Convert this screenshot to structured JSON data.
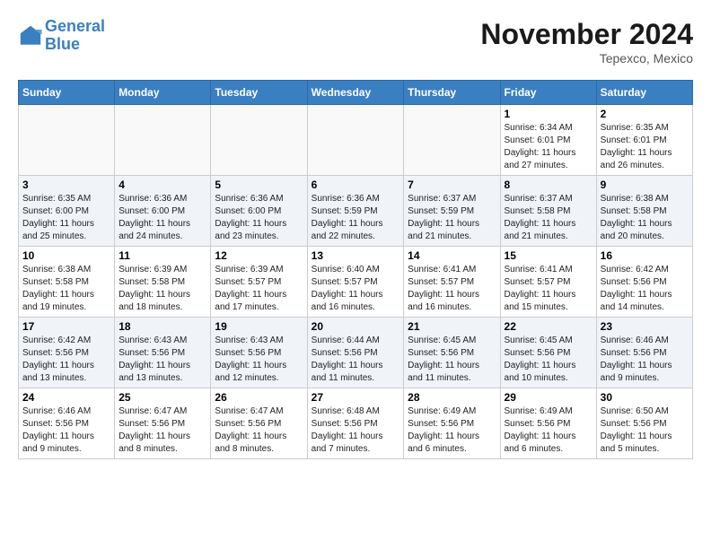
{
  "header": {
    "logo_line1": "General",
    "logo_line2": "Blue",
    "month": "November 2024",
    "location": "Tepexco, Mexico"
  },
  "weekdays": [
    "Sunday",
    "Monday",
    "Tuesday",
    "Wednesday",
    "Thursday",
    "Friday",
    "Saturday"
  ],
  "weeks": [
    [
      {
        "day": "",
        "info": ""
      },
      {
        "day": "",
        "info": ""
      },
      {
        "day": "",
        "info": ""
      },
      {
        "day": "",
        "info": ""
      },
      {
        "day": "",
        "info": ""
      },
      {
        "day": "1",
        "info": "Sunrise: 6:34 AM\nSunset: 6:01 PM\nDaylight: 11 hours\nand 27 minutes."
      },
      {
        "day": "2",
        "info": "Sunrise: 6:35 AM\nSunset: 6:01 PM\nDaylight: 11 hours\nand 26 minutes."
      }
    ],
    [
      {
        "day": "3",
        "info": "Sunrise: 6:35 AM\nSunset: 6:00 PM\nDaylight: 11 hours\nand 25 minutes."
      },
      {
        "day": "4",
        "info": "Sunrise: 6:36 AM\nSunset: 6:00 PM\nDaylight: 11 hours\nand 24 minutes."
      },
      {
        "day": "5",
        "info": "Sunrise: 6:36 AM\nSunset: 6:00 PM\nDaylight: 11 hours\nand 23 minutes."
      },
      {
        "day": "6",
        "info": "Sunrise: 6:36 AM\nSunset: 5:59 PM\nDaylight: 11 hours\nand 22 minutes."
      },
      {
        "day": "7",
        "info": "Sunrise: 6:37 AM\nSunset: 5:59 PM\nDaylight: 11 hours\nand 21 minutes."
      },
      {
        "day": "8",
        "info": "Sunrise: 6:37 AM\nSunset: 5:58 PM\nDaylight: 11 hours\nand 21 minutes."
      },
      {
        "day": "9",
        "info": "Sunrise: 6:38 AM\nSunset: 5:58 PM\nDaylight: 11 hours\nand 20 minutes."
      }
    ],
    [
      {
        "day": "10",
        "info": "Sunrise: 6:38 AM\nSunset: 5:58 PM\nDaylight: 11 hours\nand 19 minutes."
      },
      {
        "day": "11",
        "info": "Sunrise: 6:39 AM\nSunset: 5:58 PM\nDaylight: 11 hours\nand 18 minutes."
      },
      {
        "day": "12",
        "info": "Sunrise: 6:39 AM\nSunset: 5:57 PM\nDaylight: 11 hours\nand 17 minutes."
      },
      {
        "day": "13",
        "info": "Sunrise: 6:40 AM\nSunset: 5:57 PM\nDaylight: 11 hours\nand 16 minutes."
      },
      {
        "day": "14",
        "info": "Sunrise: 6:41 AM\nSunset: 5:57 PM\nDaylight: 11 hours\nand 16 minutes."
      },
      {
        "day": "15",
        "info": "Sunrise: 6:41 AM\nSunset: 5:57 PM\nDaylight: 11 hours\nand 15 minutes."
      },
      {
        "day": "16",
        "info": "Sunrise: 6:42 AM\nSunset: 5:56 PM\nDaylight: 11 hours\nand 14 minutes."
      }
    ],
    [
      {
        "day": "17",
        "info": "Sunrise: 6:42 AM\nSunset: 5:56 PM\nDaylight: 11 hours\nand 13 minutes."
      },
      {
        "day": "18",
        "info": "Sunrise: 6:43 AM\nSunset: 5:56 PM\nDaylight: 11 hours\nand 13 minutes."
      },
      {
        "day": "19",
        "info": "Sunrise: 6:43 AM\nSunset: 5:56 PM\nDaylight: 11 hours\nand 12 minutes."
      },
      {
        "day": "20",
        "info": "Sunrise: 6:44 AM\nSunset: 5:56 PM\nDaylight: 11 hours\nand 11 minutes."
      },
      {
        "day": "21",
        "info": "Sunrise: 6:45 AM\nSunset: 5:56 PM\nDaylight: 11 hours\nand 11 minutes."
      },
      {
        "day": "22",
        "info": "Sunrise: 6:45 AM\nSunset: 5:56 PM\nDaylight: 11 hours\nand 10 minutes."
      },
      {
        "day": "23",
        "info": "Sunrise: 6:46 AM\nSunset: 5:56 PM\nDaylight: 11 hours\nand 9 minutes."
      }
    ],
    [
      {
        "day": "24",
        "info": "Sunrise: 6:46 AM\nSunset: 5:56 PM\nDaylight: 11 hours\nand 9 minutes."
      },
      {
        "day": "25",
        "info": "Sunrise: 6:47 AM\nSunset: 5:56 PM\nDaylight: 11 hours\nand 8 minutes."
      },
      {
        "day": "26",
        "info": "Sunrise: 6:47 AM\nSunset: 5:56 PM\nDaylight: 11 hours\nand 8 minutes."
      },
      {
        "day": "27",
        "info": "Sunrise: 6:48 AM\nSunset: 5:56 PM\nDaylight: 11 hours\nand 7 minutes."
      },
      {
        "day": "28",
        "info": "Sunrise: 6:49 AM\nSunset: 5:56 PM\nDaylight: 11 hours\nand 6 minutes."
      },
      {
        "day": "29",
        "info": "Sunrise: 6:49 AM\nSunset: 5:56 PM\nDaylight: 11 hours\nand 6 minutes."
      },
      {
        "day": "30",
        "info": "Sunrise: 6:50 AM\nSunset: 5:56 PM\nDaylight: 11 hours\nand 5 minutes."
      }
    ]
  ]
}
